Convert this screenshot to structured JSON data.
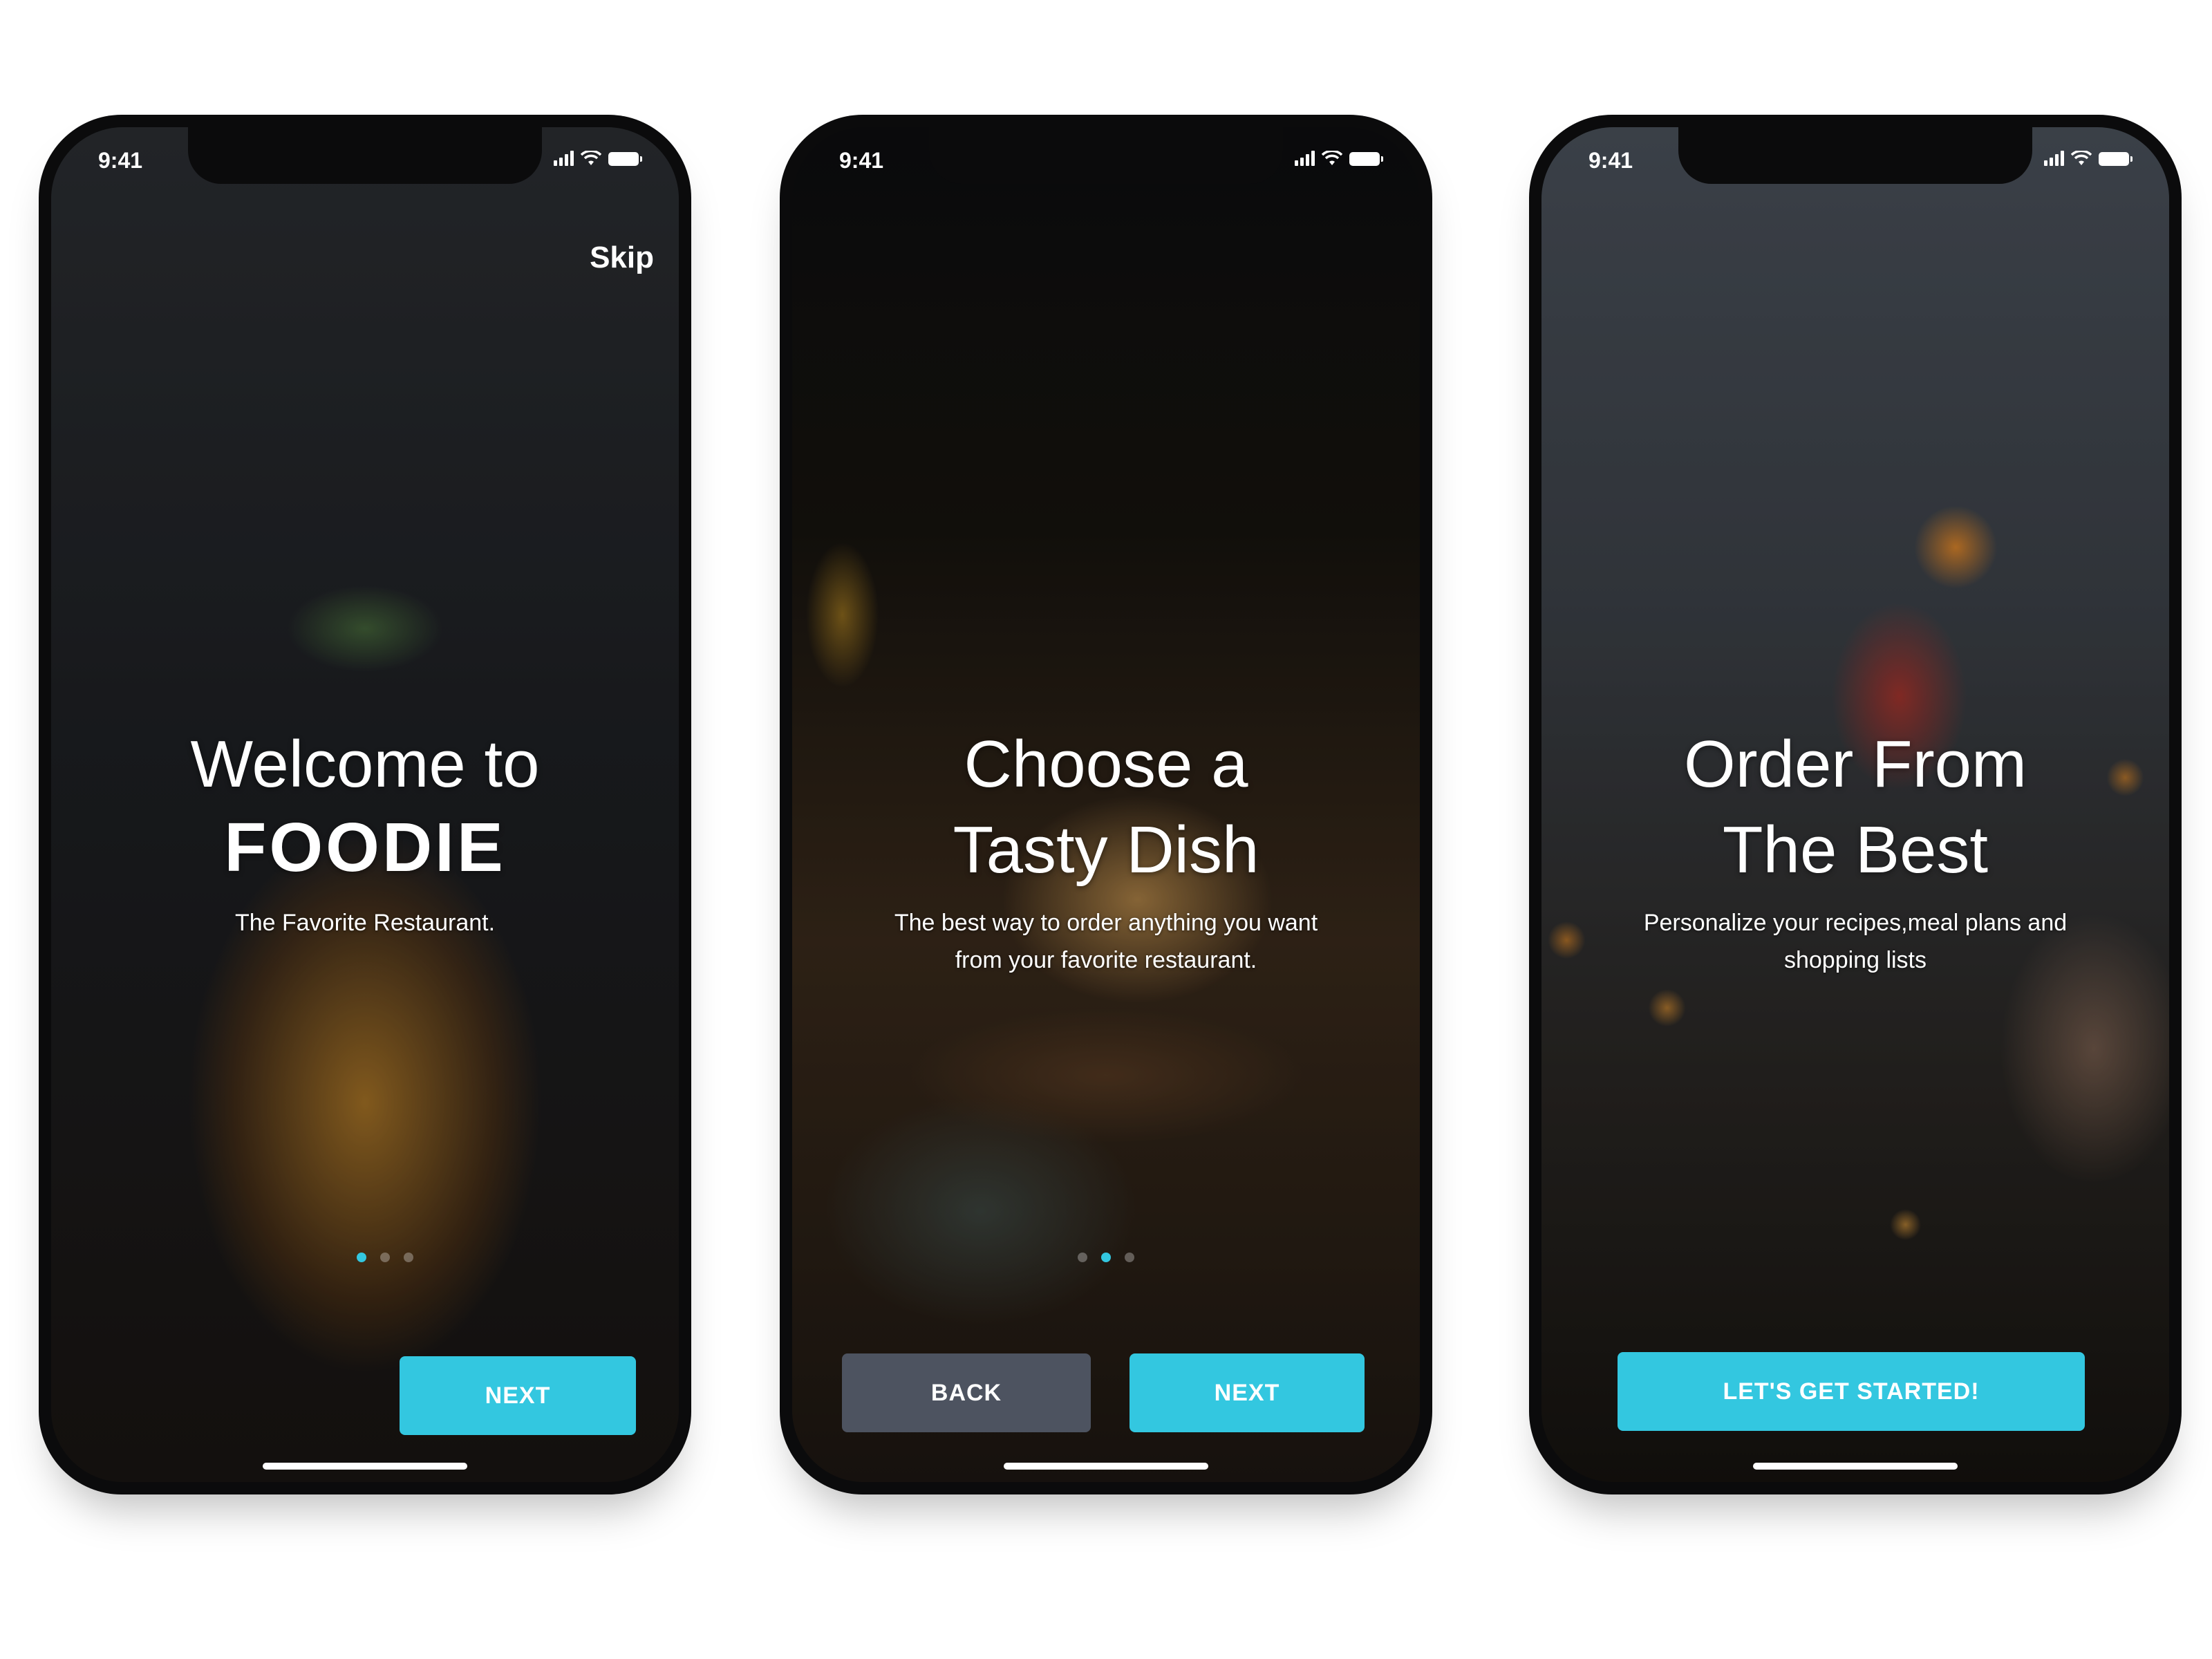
{
  "status_bar": {
    "time": "9:41"
  },
  "screens": [
    {
      "skip_label": "Skip",
      "title": "Welcome to",
      "logo_text": "FOODIE",
      "subtitle": "The Favorite Restaurant.",
      "page_indicator": {
        "current": 1,
        "total": 3
      },
      "next_label": "NEXT"
    },
    {
      "title_line1": "Choose a",
      "title_line2": "Tasty Dish",
      "subtitle_line1": "The best way to order anything you want",
      "subtitle_line2": "from your favorite restaurant.",
      "page_indicator": {
        "current": 2,
        "total": 3
      },
      "back_label": "BACK",
      "next_label": "NEXT"
    },
    {
      "title_line1": "Order From",
      "title_line2": "The Best",
      "subtitle_line1": "Personalize your recipes,meal plans and",
      "subtitle_line2": "shopping lists",
      "start_label": "LET'S GET STARTED!"
    }
  ],
  "colors": {
    "accent": "#33c7e0",
    "secondary_button": "#4d5360",
    "phone_frame": "#0b0b0c"
  }
}
